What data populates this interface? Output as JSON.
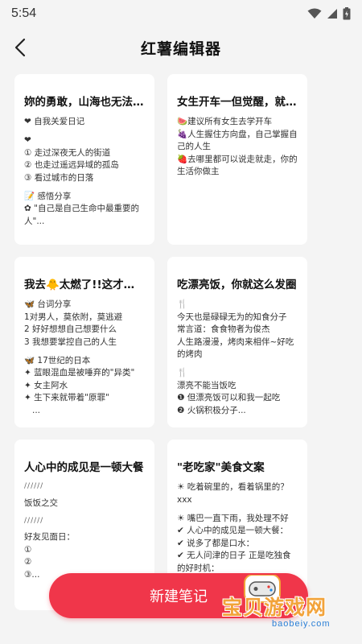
{
  "status_bar": {
    "time": "5:54"
  },
  "nav": {
    "title": "红薯编辑器"
  },
  "cards": [
    {
      "title": "妳的勇敢，山海也无法...",
      "lines": [
        "❤ 自我关爱日记",
        "",
        "❤",
        "① 走过深夜无人的街道",
        "② 也走过遥远异域的孤岛",
        "③ 看过城市的日落",
        "",
        "📝 感悟分享",
        "✿ \"自己是自己生命中最重要的",
        "人\"..."
      ]
    },
    {
      "title": "女生开车一但觉醒，就...",
      "lines": [
        "🍉建议所有女生去学开车",
        "🍇人生握住方向盘，自己掌握自",
        "己的人生",
        "🍓去哪里都可以说走就走，你的",
        "生活你做主"
      ]
    },
    {
      "title": "我去🐥太燃了!!这才是...",
      "lines": [
        "🦋 台词分享",
        "1对男人，莫依附，莫逃避",
        "2 好好想想自己想要什么",
        "3 我想要掌控自己的人生",
        "",
        "🦋 17世纪的日本",
        "✦ 蓝眼混血是被唾弃的\"异类\"",
        "✦ 女主阿水",
        "✦ 生下来就带着\"原罪\"",
        "..."
      ]
    },
    {
      "title": "吃漂亮饭，你就这么发圈",
      "lines": [
        "🍴",
        "今天也是碌碌无为的知食分子",
        "常言道：食食物者为俊杰",
        "人生路漫漫，烤肉来相伴~好吃",
        "的烤肉",
        "",
        "🍴",
        "漂亮不能当饭吃",
        "❶ 但漂亮饭可以和我一起吃",
        "❷ 火锅积极分子..."
      ]
    },
    {
      "title": "人心中的成见是一顿大餐",
      "lines": [
        "//////",
        "",
        "饭饭之交",
        "",
        "//////",
        "",
        "好友见面日：",
        "①",
        "②",
        "③..."
      ]
    },
    {
      "title": "\"老吃家\"美食文案",
      "lines": [
        "☀ 吃着碗里的，看着锅里的？",
        "xxx",
        "",
        "☀ 嘴巴一直下雨，我处理不好",
        "✔ 人心中的成见是一顿大餐：",
        "✔ 说多了都是口水：",
        "✔ 无人问津的日子 正是吃独食",
        "的好时机："
      ]
    }
  ],
  "new_note_button": {
    "label": "新建笔记"
  },
  "watermark": {
    "text": "宝贝游戏网",
    "url": "baobeiy.com"
  },
  "colors": {
    "accent": "#f0364a",
    "background": "#f4f4f4",
    "card": "#ffffff"
  }
}
